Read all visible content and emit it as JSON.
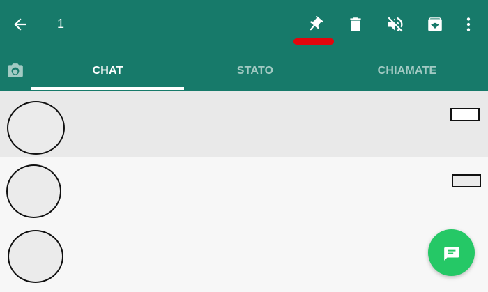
{
  "colors": {
    "app_bar": "#177a6a",
    "active_tab_text": "#ffffff",
    "inactive_tab_text": "rgba(255,255,255,0.6)",
    "selected_row": "#e9e9e9",
    "fab": "#25c866",
    "pin_highlight": "#e3050c"
  },
  "header": {
    "selected_count": "1",
    "icons": {
      "back": "arrow-left-icon",
      "pin": "pin-icon",
      "delete": "trash-icon",
      "mute": "mute-icon",
      "archive": "archive-icon",
      "more": "more-vert-icon"
    }
  },
  "tabs": {
    "camera_icon": "camera-icon",
    "items": [
      {
        "label": "CHAT",
        "active": true
      },
      {
        "label": "STATO",
        "active": false
      },
      {
        "label": "CHIAMATE",
        "active": false
      }
    ]
  },
  "chats": [
    {
      "selected": true
    },
    {
      "selected": false
    },
    {
      "selected": false
    }
  ],
  "fab": {
    "icon": "new-chat-icon"
  }
}
